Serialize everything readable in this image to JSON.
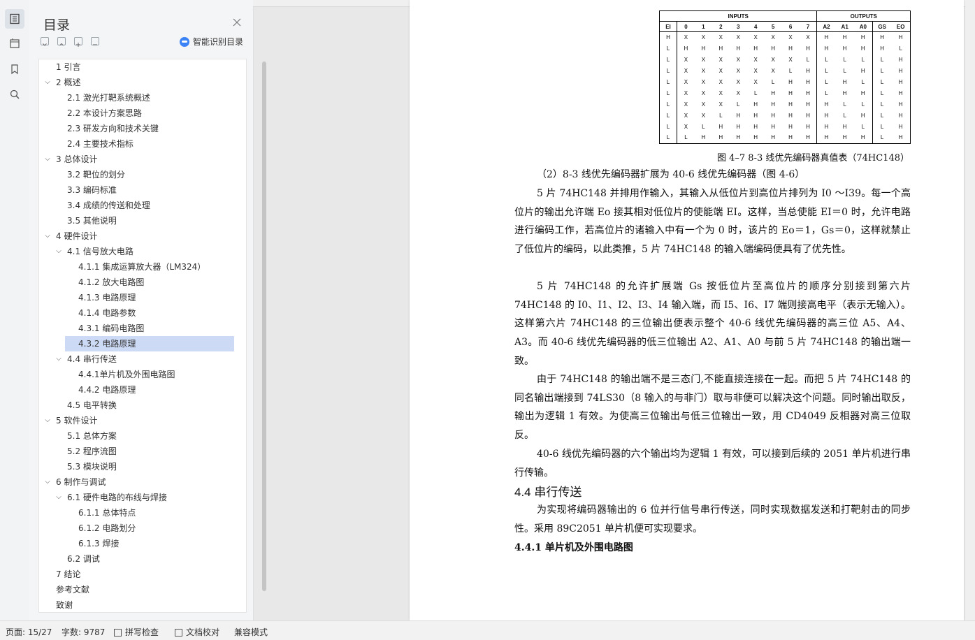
{
  "toc": {
    "title": "目录",
    "ai_label": "智能识别目录",
    "items": [
      {
        "label": "1   引言",
        "level": 1,
        "arrow": ""
      },
      {
        "label": "2   概述",
        "level": 1,
        "arrow": "v"
      },
      {
        "label": "2.1   激光打靶系统概述",
        "level": 2,
        "arrow": ""
      },
      {
        "label": "2.2   本设计方案思路",
        "level": 2,
        "arrow": ""
      },
      {
        "label": "2.3   研发方向和技术关键",
        "level": 2,
        "arrow": ""
      },
      {
        "label": "2.4   主要技术指标",
        "level": 2,
        "arrow": ""
      },
      {
        "label": "3   总体设计",
        "level": 1,
        "arrow": "v"
      },
      {
        "label": "3.2   靶位的划分",
        "level": 2,
        "arrow": ""
      },
      {
        "label": "3.3     编码标准",
        "level": 2,
        "arrow": ""
      },
      {
        "label": "3.4   成绩的传送和处理",
        "level": 2,
        "arrow": ""
      },
      {
        "label": "3.5   其他说明",
        "level": 2,
        "arrow": ""
      },
      {
        "label": "4   硬件设计",
        "level": 1,
        "arrow": "v"
      },
      {
        "label": "4.1   信号放大电路",
        "level": 2,
        "arrow": "v"
      },
      {
        "label": "4.1.1   集成运算放大器（LM324）",
        "level": 3,
        "arrow": ""
      },
      {
        "label": "4.1.2   放大电路图",
        "level": 3,
        "arrow": ""
      },
      {
        "label": "4.1.3   电路原理",
        "level": 3,
        "arrow": ""
      },
      {
        "label": "4.1.4   电路参数",
        "level": 3,
        "arrow": ""
      },
      {
        "label": "4.3.1  编码电路图",
        "level": 3,
        "arrow": ""
      },
      {
        "label": "4.3.2   电路原理",
        "level": 3,
        "arrow": "",
        "selected": true
      },
      {
        "label": "4.4   串行传送",
        "level": 2,
        "arrow": "v"
      },
      {
        "label": "4.4.1单片机及外围电路图",
        "level": 3,
        "arrow": ""
      },
      {
        "label": "4.4.2   电路原理",
        "level": 3,
        "arrow": ""
      },
      {
        "label": "4.5   电平转换",
        "level": 2,
        "arrow": ""
      },
      {
        "label": "5   软件设计",
        "level": 1,
        "arrow": "v"
      },
      {
        "label": "5.1   总体方案",
        "level": 2,
        "arrow": ""
      },
      {
        "label": "5.2   程序流图",
        "level": 2,
        "arrow": ""
      },
      {
        "label": "5.3   模块说明",
        "level": 2,
        "arrow": ""
      },
      {
        "label": "6   制作与调试",
        "level": 1,
        "arrow": "v"
      },
      {
        "label": "6.1   硬件电路的布线与焊接",
        "level": 2,
        "arrow": "v"
      },
      {
        "label": "6.1.1   总体特点",
        "level": 3,
        "arrow": ""
      },
      {
        "label": "6.1.2   电路划分",
        "level": 3,
        "arrow": ""
      },
      {
        "label": "6.1.3   焊接",
        "level": 3,
        "arrow": ""
      },
      {
        "label": "6.2   调试",
        "level": 2,
        "arrow": ""
      },
      {
        "label": "7   结论",
        "level": 1,
        "arrow": ""
      },
      {
        "label": "参考文献",
        "level": 0,
        "arrow": ""
      },
      {
        "label": "致谢",
        "level": 0,
        "arrow": ""
      }
    ]
  },
  "doc": {
    "table": {
      "group_inputs": "INPUTS",
      "group_outputs": "OUTPUTS",
      "headers": [
        "EI",
        "0",
        "1",
        "2",
        "3",
        "4",
        "5",
        "6",
        "7",
        "A2",
        "A1",
        "A0",
        "GS",
        "EO"
      ],
      "rows": [
        [
          "H",
          "X",
          "X",
          "X",
          "X",
          "X",
          "X",
          "X",
          "X",
          "H",
          "H",
          "H",
          "H",
          "H"
        ],
        [
          "L",
          "H",
          "H",
          "H",
          "H",
          "H",
          "H",
          "H",
          "H",
          "H",
          "H",
          "H",
          "H",
          "L"
        ],
        [
          "L",
          "X",
          "X",
          "X",
          "X",
          "X",
          "X",
          "X",
          "L",
          "L",
          "L",
          "L",
          "L",
          "H"
        ],
        [
          "L",
          "X",
          "X",
          "X",
          "X",
          "X",
          "X",
          "L",
          "H",
          "L",
          "L",
          "H",
          "L",
          "H"
        ],
        [
          "L",
          "X",
          "X",
          "X",
          "X",
          "X",
          "L",
          "H",
          "H",
          "L",
          "H",
          "L",
          "L",
          "H"
        ],
        [
          "L",
          "X",
          "X",
          "X",
          "X",
          "L",
          "H",
          "H",
          "H",
          "L",
          "H",
          "H",
          "L",
          "H"
        ],
        [
          "L",
          "X",
          "X",
          "X",
          "L",
          "H",
          "H",
          "H",
          "H",
          "H",
          "L",
          "L",
          "L",
          "H"
        ],
        [
          "L",
          "X",
          "X",
          "L",
          "H",
          "H",
          "H",
          "H",
          "H",
          "H",
          "L",
          "H",
          "L",
          "H"
        ],
        [
          "L",
          "X",
          "L",
          "H",
          "H",
          "H",
          "H",
          "H",
          "H",
          "H",
          "H",
          "L",
          "L",
          "H"
        ],
        [
          "L",
          "L",
          "H",
          "H",
          "H",
          "H",
          "H",
          "H",
          "H",
          "H",
          "H",
          "H",
          "L",
          "H"
        ]
      ]
    },
    "caption": "图 4–7    8-3 线优先编码器真值表（74HC148）",
    "para_sub": "（2）8-3 线优先编码器扩展为 40-6 线优先编码器（图 4-6）",
    "para1": "5 片 74HC148 并排用作输入，其输入从低位片到高位片排列为 I0 ～I39。每一个高位片的输出允许端 Eo 接其相对低位片的使能端 EI。这样，当总使能 EI＝0 时，允许电路进行编码工作，若高位片的诸输入中有一个为 0 时，该片的 Eo＝1，Gs＝0，这样就禁止了低位片的编码，以此类推，5 片 74HC148 的输入端编码便具有了优先性。",
    "para2": "5 片 74HC148 的允许扩展端 Gs 按低位片至高位片的顺序分别接到第六片 74HC148 的 I0、I1、I2、I3、I4 输入端，而 I5、I6、I7 端则接高电平（表示无输入）。这样第六片 74HC148 的三位输出便表示整个 40-6 线优先编码器的高三位 A5、A4、A3。而 40-6 线优先编码器的低三位输出 A2、A1、A0 与前 5 片 74HC148 的输出端一致。",
    "para3": "由于 74HC148 的输出端不是三态门,不能直接连接在一起。而把 5 片 74HC148 的同名输出端接到 74LS30（8 输入的与非门）取与非便可以解决这个问题。同时输出取反，输出为逻辑 1 有效。为使高三位输出与低三位输出一致，用 CD4049 反相器对高三位取反。",
    "para4": "40-6 线优先编码器的六个输出均为逻辑 1 有效，可以接到后续的 2051 单片机进行串行传输。",
    "heading_44": "4.4    串行传送",
    "para5": "为实现将编码器输出的 6 位并行信号串行传送，同时实现数据发送和打靶射击的同步性。采用 89C2051 单片机便可实现要求。",
    "heading_441": "4.4.1    单片机及外围电路图"
  },
  "status": {
    "page": "页面: 15/27",
    "words": "字数: 9787",
    "spell": "拼写检查",
    "proof": "文档校对",
    "compat": "兼容模式"
  }
}
